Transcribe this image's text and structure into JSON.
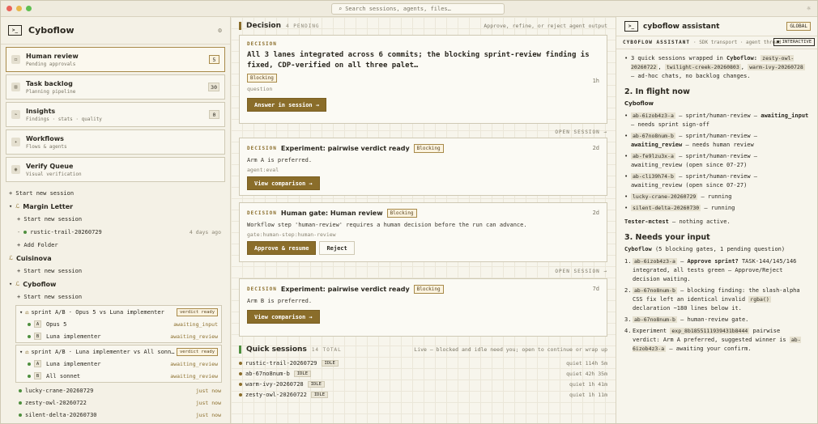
{
  "search": {
    "placeholder": "Search sessions, agents, files…"
  },
  "brand": {
    "title": "Cyboflow",
    "logo": ">_"
  },
  "nav": [
    {
      "title": "Human review",
      "sub": "Pending approvals",
      "badge": "5",
      "icon": "person-icon"
    },
    {
      "title": "Task backlog",
      "sub": "Planning pipeline",
      "badge": "30",
      "icon": "list-icon"
    },
    {
      "title": "Insights",
      "sub": "Findings · stats · quality",
      "badge": "0",
      "icon": "chart-icon"
    },
    {
      "title": "Workflows",
      "sub": "Flows & agents",
      "badge": "",
      "icon": "flow-icon"
    },
    {
      "title": "Verify Queue",
      "sub": "Visual verification",
      "badge": "",
      "icon": "eye-icon"
    }
  ],
  "tree": {
    "new_session": "+ Start new session",
    "margin_letter": "Margin Letter",
    "ml_new": "+ Start new session",
    "rustic": {
      "name": "rustic-trail-20260729",
      "time": "4 days ago"
    },
    "add_folder": "+ Add Folder",
    "cuisinova": "Cuisinova",
    "cu_new": "+ Start new session",
    "cyboflow": "Cyboflow",
    "cy_new": "+ Start new session",
    "run1": {
      "title": "sprint A/B · Opus 5 vs Luna implementer",
      "verdict": "verdict ready",
      "a": {
        "label": "A",
        "name": "Opus 5",
        "status": "awaiting_input"
      },
      "b": {
        "label": "B",
        "name": "Luna implementer",
        "status": "awaiting_review"
      }
    },
    "run2": {
      "title": "sprint A/B · Luna implementer vs All sonn…",
      "verdict": "verdict ready",
      "a": {
        "label": "A",
        "name": "Luna implementer",
        "status": "awaiting_review"
      },
      "b": {
        "label": "B",
        "name": "All sonnet",
        "status": "awaiting_review"
      }
    },
    "sessions": [
      {
        "name": "lucky-crane-20260729",
        "time": "just now"
      },
      {
        "name": "zesty-owl-20260722",
        "time": "just now"
      },
      {
        "name": "silent-delta-20260730",
        "time": "just now"
      }
    ]
  },
  "decision": {
    "title": "Decision",
    "count": "4 PENDING",
    "hint": "Approve, refine, or reject agent output",
    "top": {
      "tag": "DECISION",
      "text": "All 3 lanes integrated across 6 commits; the blocking sprint-review finding is fixed, CDP-verified on all three palet…",
      "badge": "Blocking",
      "age": "1h",
      "meta": "question",
      "button": "Answer in session →"
    },
    "open_session": "OPEN SESSION →",
    "cards": [
      {
        "tag": "DECISION",
        "title": "Experiment: pairwise verdict ready",
        "badge": "Blocking",
        "age": "2d",
        "text": "Arm A is preferred.",
        "meta": "agent:eval",
        "primary": "View comparison →",
        "secondary": ""
      },
      {
        "tag": "DECISION",
        "title": "Human gate: Human review",
        "badge": "Blocking",
        "age": "2d",
        "text": "Workflow step 'human-review' requires a human decision before the run can advance.",
        "meta": "gate:human-step:human-review",
        "primary": "Approve & resume",
        "secondary": "Reject"
      },
      {
        "tag": "DECISION",
        "title": "Experiment: pairwise verdict ready",
        "badge": "Blocking",
        "age": "7d",
        "text": "Arm B is preferred.",
        "meta": "",
        "primary": "View comparison →",
        "secondary": ""
      }
    ]
  },
  "quick": {
    "title": "Quick sessions",
    "count": "14 TOTAL",
    "hint": "Live — blocked and idle need you; open to continue or wrap up",
    "rows": [
      {
        "name": "rustic-trail-20260729",
        "badge": "IDLE",
        "time": "quiet 114h 5m"
      },
      {
        "name": "ab-67no8num-b",
        "badge": "IDLE",
        "time": "quiet 42h 35m"
      },
      {
        "name": "warm-ivy-20260728",
        "badge": "IDLE",
        "time": "quiet 1h 41m"
      },
      {
        "name": "zesty-owl-20260722",
        "badge": "IDLE",
        "time": "quiet 1h 11m"
      }
    ]
  },
  "assistant": {
    "logo": ">_",
    "title": "cyboflow assistant",
    "global": "GLOBAL",
    "sub_label": "CYBOFLOW ASSISTANT",
    "sub_text": "· SDK transport · agent thread",
    "interactive": "● INTERACTIVE",
    "intro_a": "3 quick sessions wrapped in",
    "intro_b": "Cyboflow:",
    "intro_c1": "zesty-owl-20260722",
    "intro_c2": "twilight-creek-20260803",
    "intro_c3": "warm-ivy-20260728",
    "intro_d": "— ad-hoc chats, no backlog changes.",
    "h_inflight": "2. In flight now",
    "cyboflow": "Cyboflow",
    "inflight": [
      {
        "code": "ab-6izob4z3-a",
        "a": "— sprint/human-review —",
        "b": "awaiting_input",
        "c": "— needs sprint sign-off"
      },
      {
        "code": "ab-67no8num-b",
        "a": "— sprint/human-review —",
        "b": "awaiting_review",
        "c": "— needs human review"
      },
      {
        "code": "ab-fe9lzu3x-a",
        "a": "— sprint/human-review — awaiting_review (open since 07-27)",
        "b": "",
        "c": ""
      },
      {
        "code": "ab-cli39h74-b",
        "a": "— sprint/human-review — awaiting_review (open since 07-27)",
        "b": "",
        "c": ""
      },
      {
        "code": "lucky-crane-20260729",
        "a": "— running",
        "b": "",
        "c": ""
      },
      {
        "code": "silent-delta-20260730",
        "a": "— running",
        "b": "",
        "c": ""
      }
    ],
    "tester": "Tester-mctest",
    "tester_text": "— nothing active.",
    "h_needs": "3. Needs your input",
    "needs_a": "Cyboflow",
    "needs_b": "(5 blocking gates, 1 pending question)",
    "needs": [
      {
        "n": "1.",
        "code": "ab-6izob4z3-a",
        "bold": "Approve sprint?",
        "text": "TASK-144/145/146 integrated, all tests green — Approve/Reject decision waiting."
      },
      {
        "n": "2.",
        "code": "ab-67no8num-b",
        "bold": "",
        "text": "— blocking finding: the slash-alpha CSS fix left an identical invalid",
        "code2": "rgba()",
        "text2": "declaration ~180 lines below it."
      },
      {
        "n": "3.",
        "code": "ab-67no8num-b",
        "bold": "",
        "text": "— human-review gate."
      },
      {
        "n": "4.",
        "pre": "Experiment",
        "code": "exp_8b1855111939431b8444",
        "text": "pairwise verdict: Arm A preferred, suggested winner is",
        "code2": "ab-6izob4z3-a",
        "text2": "— awaiting your confirm."
      }
    ]
  }
}
